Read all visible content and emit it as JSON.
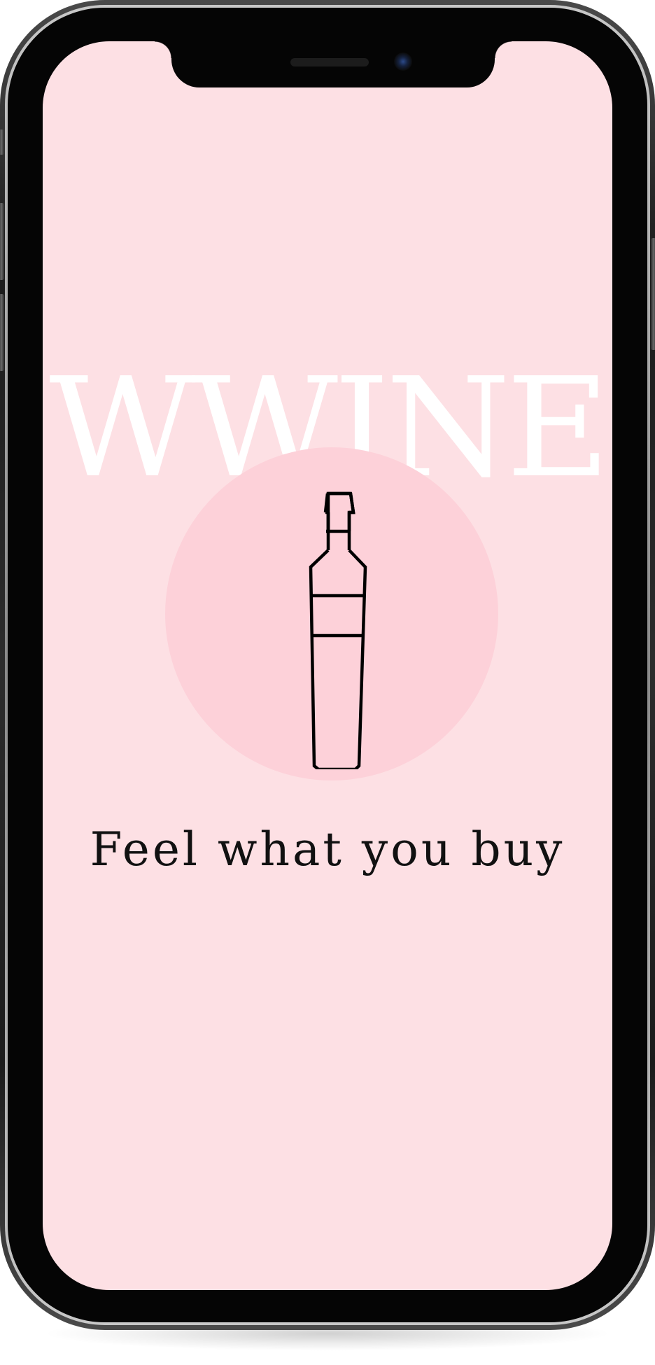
{
  "app": {
    "brand_name": "WWINE",
    "tagline": "Feel what you buy",
    "hero_icon": "wine-bottle-icon"
  },
  "theme": {
    "screen_background": "#fde0e4",
    "circle_color": "#fdd1d9",
    "brand_text_color": "#ffffff",
    "tagline_color": "#111111",
    "bottle_stroke": "#000000"
  }
}
